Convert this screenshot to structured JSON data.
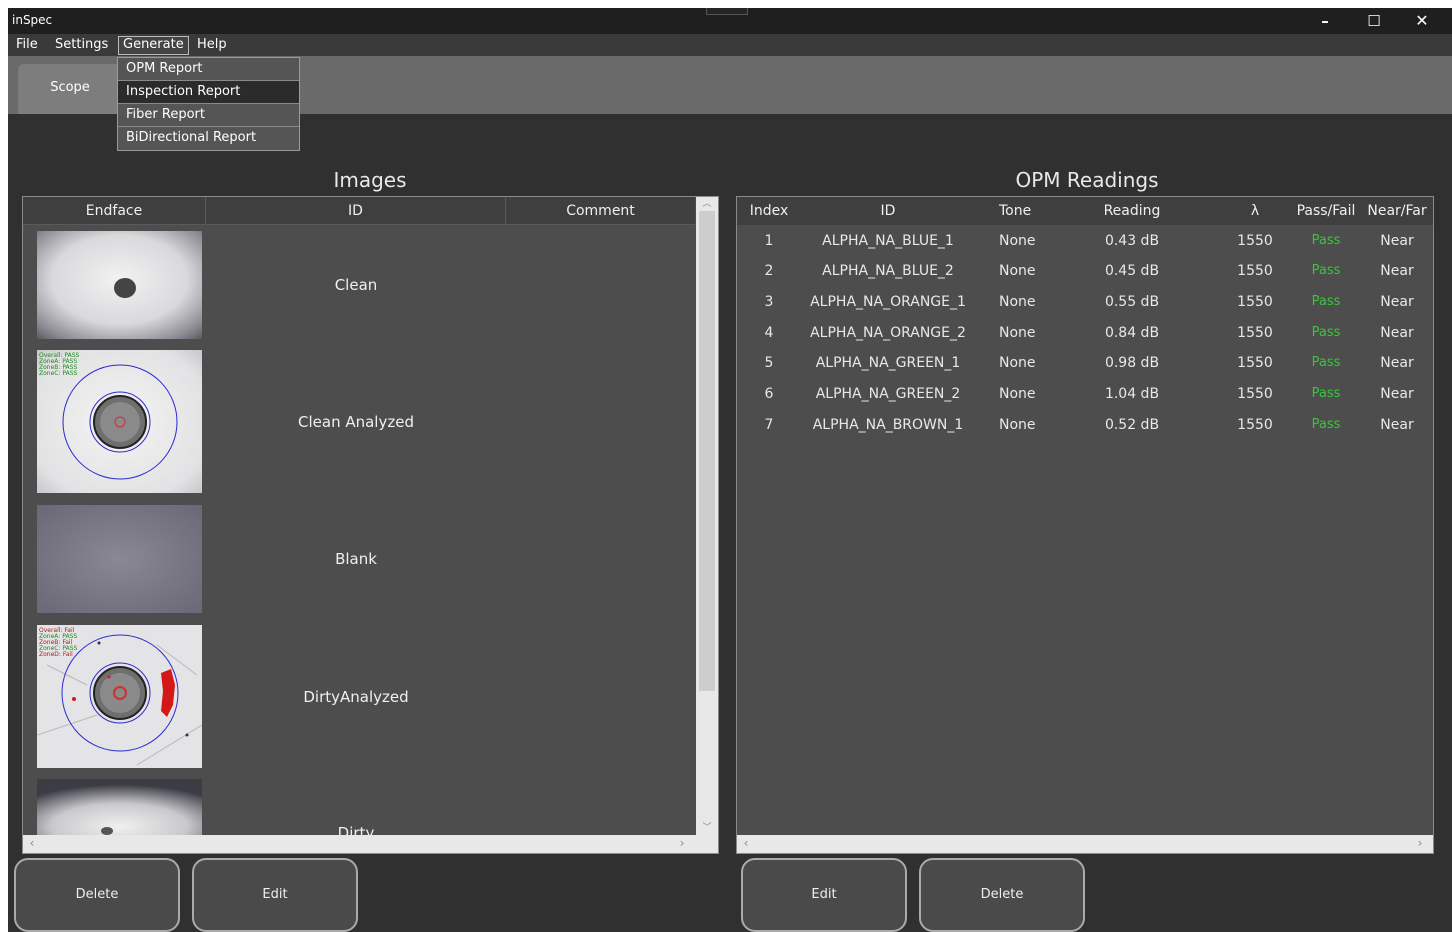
{
  "app": {
    "title": "inSpec"
  },
  "window_controls": {
    "minimize": "–",
    "maximize": "☐",
    "close": "✕"
  },
  "menu": {
    "file": "File",
    "settings": "Settings",
    "generate": "Generate",
    "help": "Help",
    "generate_items": [
      "OPM Report",
      "Inspection Report",
      "Fiber Report",
      "BiDirectional Report"
    ],
    "highlighted_item": "Inspection Report"
  },
  "ribbon": {
    "tab_scope": "Scope"
  },
  "images": {
    "title": "Images",
    "columns": [
      "Endface",
      "ID",
      "Comment"
    ],
    "rows": [
      {
        "id": "Clean",
        "comment": "",
        "thumb": "clean"
      },
      {
        "id": "Clean Analyzed",
        "comment": "",
        "thumb": "clean-analyzed",
        "overlay": [
          "Overall: PASS",
          "ZoneA: PASS",
          "ZoneB: PASS",
          "ZoneC: PASS"
        ]
      },
      {
        "id": "Blank",
        "comment": "",
        "thumb": "blank"
      },
      {
        "id": "DirtyAnalyzed",
        "comment": "",
        "thumb": "dirty-analyzed",
        "overlay": [
          "Overall: Fail",
          "ZoneA: PASS",
          "ZoneB: Fail",
          "ZoneC: PASS",
          "ZoneD: Fail"
        ]
      },
      {
        "id": "Dirty",
        "comment": "",
        "thumb": "dirty"
      }
    ]
  },
  "opm": {
    "title": "OPM Readings",
    "columns": [
      "Index",
      "ID",
      "Tone",
      "Reading",
      "λ",
      "Pass/Fail",
      "Near/Far"
    ],
    "rows": [
      {
        "index": "1",
        "id": "ALPHA_NA_BLUE_1",
        "tone": "None",
        "reading": "0.43 dB",
        "lambda": "1550",
        "pass": "Pass",
        "near": "Near"
      },
      {
        "index": "2",
        "id": "ALPHA_NA_BLUE_2",
        "tone": "None",
        "reading": "0.45 dB",
        "lambda": "1550",
        "pass": "Pass",
        "near": "Near"
      },
      {
        "index": "3",
        "id": "ALPHA_NA_ORANGE_1",
        "tone": "None",
        "reading": "0.55 dB",
        "lambda": "1550",
        "pass": "Pass",
        "near": "Near"
      },
      {
        "index": "4",
        "id": "ALPHA_NA_ORANGE_2",
        "tone": "None",
        "reading": "0.84 dB",
        "lambda": "1550",
        "pass": "Pass",
        "near": "Near"
      },
      {
        "index": "5",
        "id": "ALPHA_NA_GREEN_1",
        "tone": "None",
        "reading": "0.98 dB",
        "lambda": "1550",
        "pass": "Pass",
        "near": "Near"
      },
      {
        "index": "6",
        "id": "ALPHA_NA_GREEN_2",
        "tone": "None",
        "reading": "1.04 dB",
        "lambda": "1550",
        "pass": "Pass",
        "near": "Near"
      },
      {
        "index": "7",
        "id": "ALPHA_NA_BROWN_1",
        "tone": "None",
        "reading": "0.52 dB",
        "lambda": "1550",
        "pass": "Pass",
        "near": "Near"
      }
    ]
  },
  "buttons": {
    "images_delete": "Delete",
    "images_edit": "Edit",
    "opm_edit": "Edit",
    "opm_delete": "Delete"
  },
  "colors": {
    "pass": "#3cc43c",
    "background": "#303030",
    "panel": "#4d4d4d",
    "ribbon": "#6a6a6a"
  }
}
